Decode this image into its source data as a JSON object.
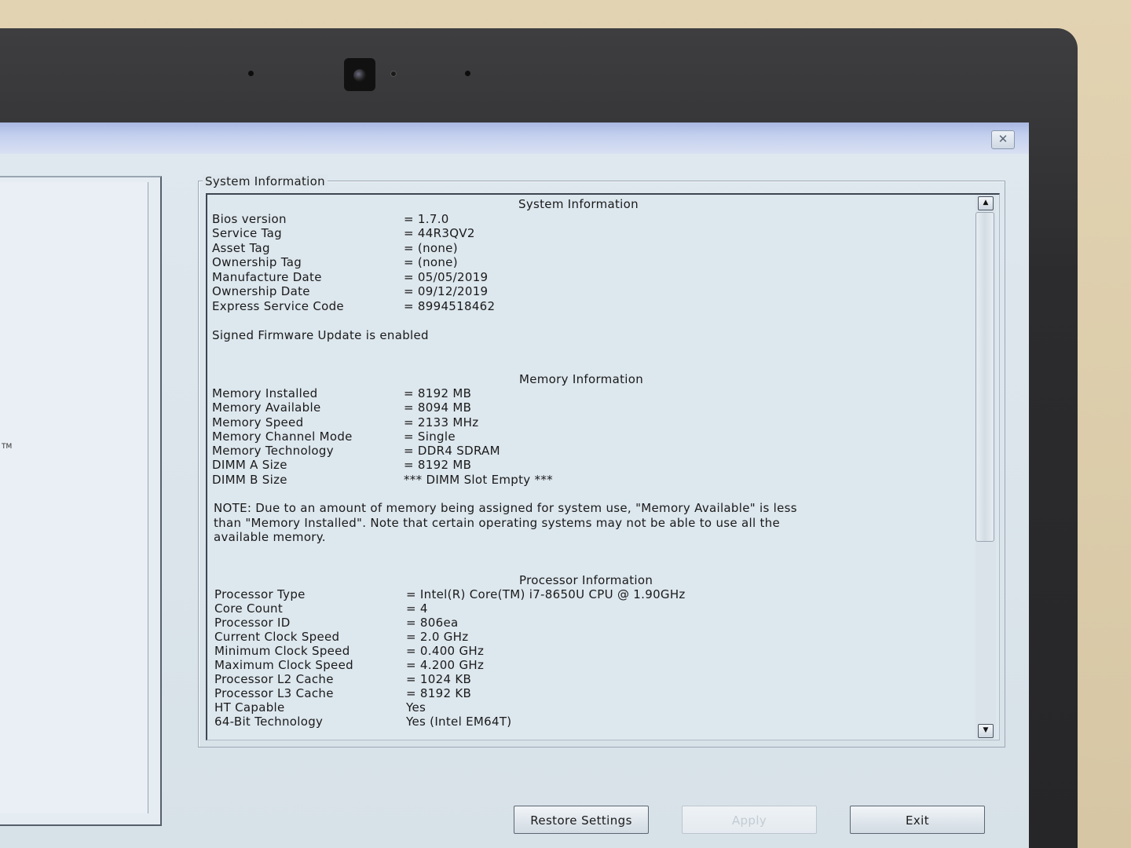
{
  "window": {
    "close_glyph": "✕"
  },
  "nav": {
    "fragment_label": "TM"
  },
  "group": {
    "label": "System Information"
  },
  "sections": [
    {
      "heading": "System Information",
      "rows": [
        {
          "key": "Bios version",
          "value": "= 1.7.0"
        },
        {
          "key": "Service Tag",
          "value": "= 44R3QV2"
        },
        {
          "key": "Asset Tag",
          "value": "= (none)"
        },
        {
          "key": "Ownership Tag",
          "value": "= (none)"
        },
        {
          "key": "Manufacture Date",
          "value": "= 05/05/2019"
        },
        {
          "key": "Ownership Date",
          "value": "= 09/12/2019"
        },
        {
          "key": "Express Service Code",
          "value": "= 8994518462"
        }
      ],
      "note": "Signed Firmware Update is enabled"
    },
    {
      "heading": "Memory Information",
      "rows": [
        {
          "key": "Memory Installed",
          "value": "= 8192 MB"
        },
        {
          "key": "Memory Available",
          "value": "= 8094 MB"
        },
        {
          "key": "Memory Speed",
          "value": "= 2133 MHz"
        },
        {
          "key": "Memory Channel Mode",
          "value": "= Single"
        },
        {
          "key": "Memory Technology",
          "value": "= DDR4 SDRAM"
        },
        {
          "key": "DIMM A Size",
          "value": "= 8192 MB"
        },
        {
          "key": "DIMM B Size",
          "value": "*** DIMM Slot Empty ***"
        }
      ],
      "note_lines": [
        "NOTE: Due to an amount of memory being assigned for system use, \"Memory Available\" is less",
        "than \"Memory Installed\". Note that certain operating systems may not be able to use all the",
        "available memory."
      ]
    },
    {
      "heading": "Processor Information",
      "rows": [
        {
          "key": "Processor Type",
          "value": "= Intel(R) Core(TM) i7-8650U CPU @ 1.90GHz"
        },
        {
          "key": "Core Count",
          "value": "= 4"
        },
        {
          "key": "Processor ID",
          "value": "= 806ea"
        },
        {
          "key": "Current Clock Speed",
          "value": "= 2.0 GHz"
        },
        {
          "key": "Minimum Clock Speed",
          "value": "= 0.400 GHz"
        },
        {
          "key": "Maximum Clock Speed",
          "value": "= 4.200 GHz"
        },
        {
          "key": "Processor L2 Cache",
          "value": "= 1024 KB"
        },
        {
          "key": "Processor L3 Cache",
          "value": "= 8192 KB"
        },
        {
          "key": "HT Capable",
          "value": "Yes"
        },
        {
          "key": "64-Bit Technology",
          "value": "Yes (Intel EM64T)"
        }
      ]
    }
  ],
  "scrollbar": {
    "up_glyph": "▲",
    "down_glyph": "▼"
  },
  "buttons": {
    "restore": "Restore Settings",
    "apply": "Apply",
    "exit": "Exit"
  }
}
